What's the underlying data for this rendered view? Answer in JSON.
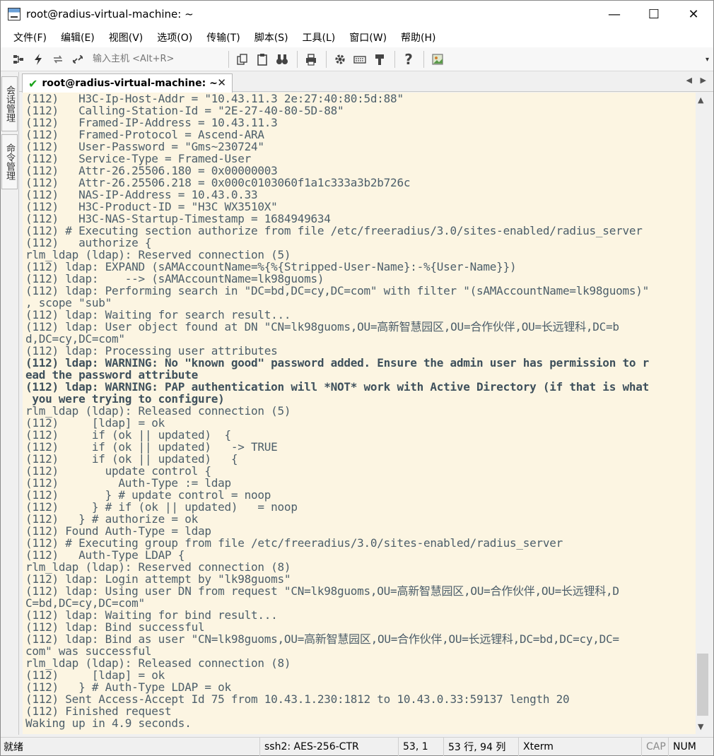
{
  "window": {
    "title": "root@radius-virtual-machine: ~",
    "controls": {
      "minimize": "—",
      "maximize": "☐",
      "close": "✕"
    }
  },
  "menu": [
    "文件(F)",
    "编辑(E)",
    "视图(V)",
    "选项(O)",
    "传输(T)",
    "脚本(S)",
    "工具(L)",
    "窗口(W)",
    "帮助(H)"
  ],
  "toolbar": {
    "host_placeholder": "输入主机 <Alt+R>"
  },
  "side_tabs": [
    "会话管理",
    "命令管理"
  ],
  "session_tab": {
    "label": "root@radius-virtual-machine: ~",
    "close": "✕"
  },
  "terminal": {
    "lines": [
      {
        "text": "(112)   H3C-Ip-Host-Addr = \"10.43.11.3 2e:27:40:80:5d:88\"",
        "bold": false
      },
      {
        "text": "(112)   Calling-Station-Id = \"2E-27-40-80-5D-88\"",
        "bold": false
      },
      {
        "text": "(112)   Framed-IP-Address = 10.43.11.3",
        "bold": false
      },
      {
        "text": "(112)   Framed-Protocol = Ascend-ARA",
        "bold": false
      },
      {
        "text": "(112)   User-Password = \"Gms~230724\"",
        "bold": false
      },
      {
        "text": "(112)   Service-Type = Framed-User",
        "bold": false
      },
      {
        "text": "(112)   Attr-26.25506.180 = 0x00000003",
        "bold": false
      },
      {
        "text": "(112)   Attr-26.25506.218 = 0x000c0103060f1a1c333a3b2b726c",
        "bold": false
      },
      {
        "text": "(112)   NAS-IP-Address = 10.43.0.33",
        "bold": false
      },
      {
        "text": "(112)   H3C-Product-ID = \"H3C WX3510X\"",
        "bold": false
      },
      {
        "text": "(112)   H3C-NAS-Startup-Timestamp = 1684949634",
        "bold": false
      },
      {
        "text": "(112) # Executing section authorize from file /etc/freeradius/3.0/sites-enabled/radius_server",
        "bold": false
      },
      {
        "text": "(112)   authorize {",
        "bold": false
      },
      {
        "text": "rlm_ldap (ldap): Reserved connection (5)",
        "bold": false
      },
      {
        "text": "(112) ldap: EXPAND (sAMAccountName=%{%{Stripped-User-Name}:-%{User-Name}})",
        "bold": false
      },
      {
        "text": "(112) ldap:    --> (sAMAccountName=lk98guoms)",
        "bold": false
      },
      {
        "text": "(112) ldap: Performing search in \"DC=bd,DC=cy,DC=com\" with filter \"(sAMAccountName=lk98guoms)\"",
        "bold": false
      },
      {
        "text": ", scope \"sub\"",
        "bold": false
      },
      {
        "text": "(112) ldap: Waiting for search result...",
        "bold": false
      },
      {
        "text": "(112) ldap: User object found at DN \"CN=lk98guoms,OU=高新智慧园区,OU=合作伙伴,OU=长远锂科,DC=b",
        "bold": false
      },
      {
        "text": "d,DC=cy,DC=com\"",
        "bold": false
      },
      {
        "text": "(112) ldap: Processing user attributes",
        "bold": false
      },
      {
        "text": "(112) ldap: WARNING: No \"known good\" password added. Ensure the admin user has permission to r",
        "bold": true
      },
      {
        "text": "ead the password attribute",
        "bold": true
      },
      {
        "text": "(112) ldap: WARNING: PAP authentication will *NOT* work with Active Directory (if that is what",
        "bold": true
      },
      {
        "text": " you were trying to configure)",
        "bold": true
      },
      {
        "text": "rlm_ldap (ldap): Released connection (5)",
        "bold": false
      },
      {
        "text": "(112)     [ldap] = ok",
        "bold": false
      },
      {
        "text": "(112)     if (ok || updated)  {",
        "bold": false
      },
      {
        "text": "(112)     if (ok || updated)   -> TRUE",
        "bold": false
      },
      {
        "text": "(112)     if (ok || updated)   {",
        "bold": false
      },
      {
        "text": "(112)       update control {",
        "bold": false
      },
      {
        "text": "(112)         Auth-Type := ldap",
        "bold": false
      },
      {
        "text": "(112)       } # update control = noop",
        "bold": false
      },
      {
        "text": "(112)     } # if (ok || updated)   = noop",
        "bold": false
      },
      {
        "text": "(112)   } # authorize = ok",
        "bold": false
      },
      {
        "text": "(112) Found Auth-Type = ldap",
        "bold": false
      },
      {
        "text": "(112) # Executing group from file /etc/freeradius/3.0/sites-enabled/radius_server",
        "bold": false
      },
      {
        "text": "(112)   Auth-Type LDAP {",
        "bold": false
      },
      {
        "text": "rlm_ldap (ldap): Reserved connection (8)",
        "bold": false
      },
      {
        "text": "(112) ldap: Login attempt by \"lk98guoms\"",
        "bold": false
      },
      {
        "text": "(112) ldap: Using user DN from request \"CN=lk98guoms,OU=高新智慧园区,OU=合作伙伴,OU=长远锂科,D",
        "bold": false
      },
      {
        "text": "C=bd,DC=cy,DC=com\"",
        "bold": false
      },
      {
        "text": "(112) ldap: Waiting for bind result...",
        "bold": false
      },
      {
        "text": "(112) ldap: Bind successful",
        "bold": false
      },
      {
        "text": "(112) ldap: Bind as user \"CN=lk98guoms,OU=高新智慧园区,OU=合作伙伴,OU=长远锂科,DC=bd,DC=cy,DC=",
        "bold": false
      },
      {
        "text": "com\" was successful",
        "bold": false
      },
      {
        "text": "rlm_ldap (ldap): Released connection (8)",
        "bold": false
      },
      {
        "text": "(112)     [ldap] = ok",
        "bold": false
      },
      {
        "text": "(112)   } # Auth-Type LDAP = ok",
        "bold": false
      },
      {
        "text": "(112) Sent Access-Accept Id 75 from 10.43.1.230:1812 to 10.43.0.33:59137 length 20",
        "bold": false
      },
      {
        "text": "(112) Finished request",
        "bold": false
      },
      {
        "text": "Waking up in 4.9 seconds.",
        "bold": false
      }
    ]
  },
  "statusbar": {
    "ready": "就绪",
    "cipher": "ssh2: AES-256-CTR",
    "cursor": "53,  1",
    "size": "53 行, 94 列",
    "emulation": "Xterm",
    "caps": "CAP",
    "num": "NUM"
  }
}
